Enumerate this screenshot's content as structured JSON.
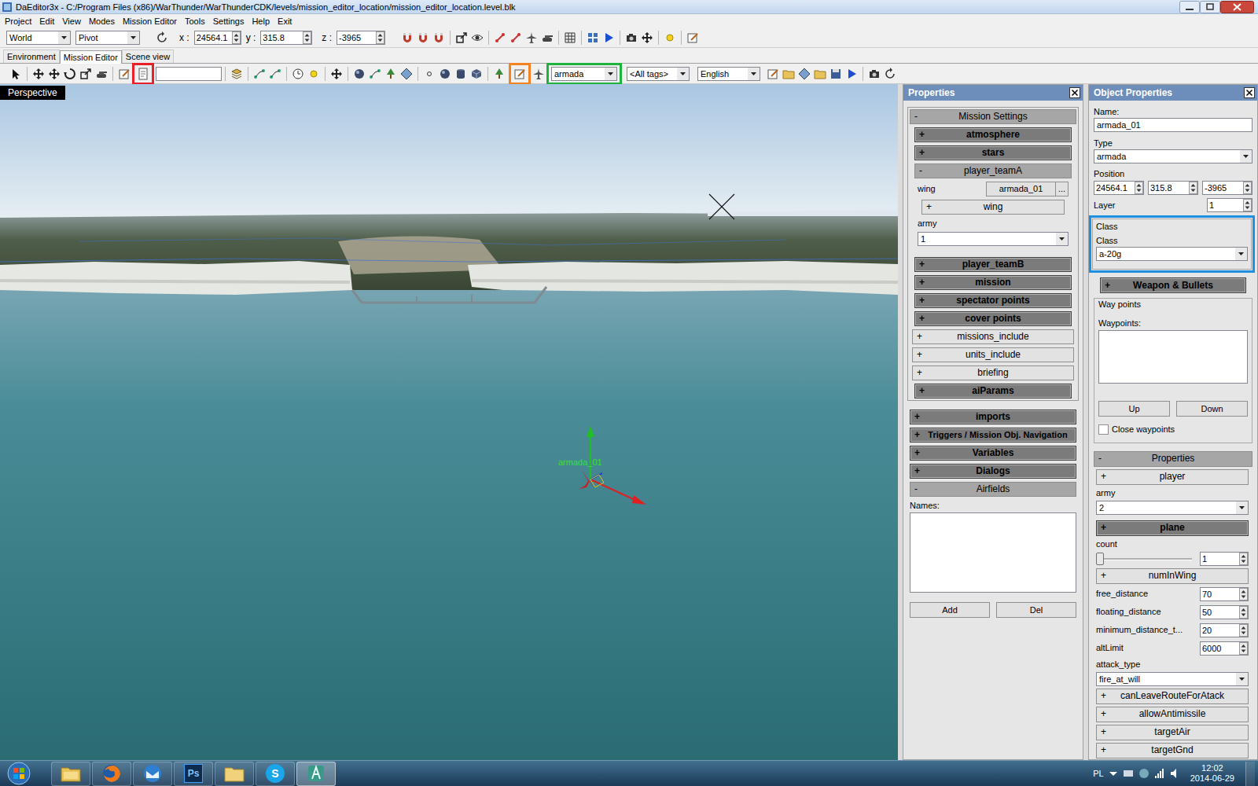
{
  "window": {
    "title": "DaEditor3x - C:/Program Files (x86)/WarThunder/WarThunderCDK/levels/mission_editor_location/mission_editor_location.level.blk"
  },
  "menu": [
    "Project",
    "Edit",
    "View",
    "Modes",
    "Mission Editor",
    "Tools",
    "Settings",
    "Help",
    "Exit"
  ],
  "toolbar": {
    "space": "World",
    "pivot": "Pivot",
    "x_label": "x :",
    "x": "24564.1",
    "y_label": "y :",
    "y": "315.8",
    "z_label": "z :",
    "z": "-3965"
  },
  "tabs": [
    {
      "label": "Environment",
      "selected": false
    },
    {
      "label": "Mission Editor",
      "selected": true
    },
    {
      "label": "Scene view",
      "selected": false
    }
  ],
  "mission_toolbar": {
    "search": "",
    "doc_highlight": "#e8202a",
    "create_highlight": "#f58220",
    "type_filter": "armada",
    "type_highlight": "#1db33c",
    "tags": "<All tags>",
    "language": "English"
  },
  "viewport": {
    "label": "Perspective",
    "object_label": "armada_01"
  },
  "properties": {
    "title": "Properties",
    "mission_settings": {
      "kind": "header",
      "toggle": "-",
      "label": "Mission Settings",
      "expanded": true,
      "items": [
        {
          "kind": "group",
          "toggle": "+",
          "label": "atmosphere",
          "expanded": false
        },
        {
          "kind": "group",
          "toggle": "+",
          "label": "stars",
          "expanded": false
        },
        {
          "kind": "header",
          "toggle": "-",
          "label": "player_teamA",
          "expanded": true
        },
        {
          "kind": "field-button",
          "label": "wing",
          "value": "armada_01",
          "button": "..."
        },
        {
          "kind": "sub-button",
          "toggle": "+",
          "label": "wing",
          "expanded": false
        },
        {
          "kind": "select",
          "label": "army",
          "value": "1"
        },
        {
          "kind": "group",
          "toggle": "+",
          "label": "player_teamB",
          "expanded": false
        },
        {
          "kind": "group",
          "toggle": "+",
          "label": "mission",
          "expanded": false
        },
        {
          "kind": "group",
          "toggle": "+",
          "label": "spectator points",
          "expanded": false
        },
        {
          "kind": "group",
          "toggle": "+",
          "label": "cover points",
          "expanded": false
        },
        {
          "kind": "button",
          "toggle": "+",
          "label": "missions_include",
          "expanded": false
        },
        {
          "kind": "button",
          "toggle": "+",
          "label": "units_include",
          "expanded": false
        },
        {
          "kind": "button",
          "toggle": "+",
          "label": "briefing",
          "expanded": false
        },
        {
          "kind": "group",
          "toggle": "+",
          "label": "aiParams",
          "expanded": false
        }
      ]
    },
    "sections": [
      {
        "kind": "group",
        "toggle": "+",
        "label": "imports",
        "expanded": false
      },
      {
        "kind": "group",
        "toggle": "+",
        "label": "Triggers / Mission Obj. Navigation",
        "expanded": false
      },
      {
        "kind": "group",
        "toggle": "+",
        "label": "Variables",
        "expanded": false
      },
      {
        "kind": "group",
        "toggle": "+",
        "label": "Dialogs",
        "expanded": false
      },
      {
        "kind": "header",
        "toggle": "-",
        "label": "Airfields",
        "expanded": true
      }
    ],
    "airfields": {
      "names_label": "Names:",
      "names": [],
      "add": "Add",
      "del": "Del"
    }
  },
  "object": {
    "title": "Object Properties",
    "name_label": "Name:",
    "name": "armada_01",
    "type_label": "Type",
    "type": "armada",
    "position_label": "Position",
    "position": [
      "24564.1",
      "315.8",
      "-3965"
    ],
    "layer_label": "Layer",
    "layer": "1",
    "class_group": "Class",
    "class_label": "Class",
    "class": "a-20g",
    "class_highlight": "#1e8fe1",
    "weapons": {
      "kind": "group",
      "toggle": "+",
      "label": "Weapon & Bullets",
      "expanded": false
    },
    "waypoints_group": "Way points",
    "waypoints_label": "Waypoints:",
    "waypoints": [],
    "up": "Up",
    "down": "Down",
    "close_waypoints": {
      "label": "Close waypoints",
      "checked": false
    },
    "props": {
      "kind": "header",
      "toggle": "-",
      "label": "Properties",
      "expanded": true
    },
    "rows": [
      {
        "kind": "button",
        "toggle": "+",
        "label": "player",
        "expanded": false
      },
      {
        "kind": "select",
        "label": "army",
        "value": "2"
      },
      {
        "kind": "group",
        "toggle": "+",
        "label": "plane",
        "expanded": false
      },
      {
        "kind": "slider",
        "label": "count",
        "value": "1",
        "level": 0
      },
      {
        "kind": "button",
        "toggle": "+",
        "label": "numInWing",
        "expanded": false
      },
      {
        "kind": "spin",
        "label": "free_distance",
        "value": "70"
      },
      {
        "kind": "spin",
        "label": "floating_distance",
        "value": "50"
      },
      {
        "kind": "spin",
        "label": "minimum_distance_t...",
        "value": "20"
      },
      {
        "kind": "spin",
        "label": "altLimit",
        "value": "6000"
      },
      {
        "kind": "select",
        "label": "attack_type",
        "value": "fire_at_will"
      },
      {
        "kind": "button",
        "toggle": "+",
        "label": "canLeaveRouteForAtack",
        "expanded": false
      },
      {
        "kind": "button",
        "toggle": "+",
        "label": "allowAntimissile",
        "expanded": false
      },
      {
        "kind": "button",
        "toggle": "+",
        "label": "targetAir",
        "expanded": false
      },
      {
        "kind": "button",
        "toggle": "+",
        "label": "targetGnd",
        "expanded": false
      }
    ]
  },
  "taskbar": {
    "photoshop": "Ps",
    "skype": "S",
    "language": "PL",
    "time": "12:02",
    "date": "2014-06-29"
  }
}
